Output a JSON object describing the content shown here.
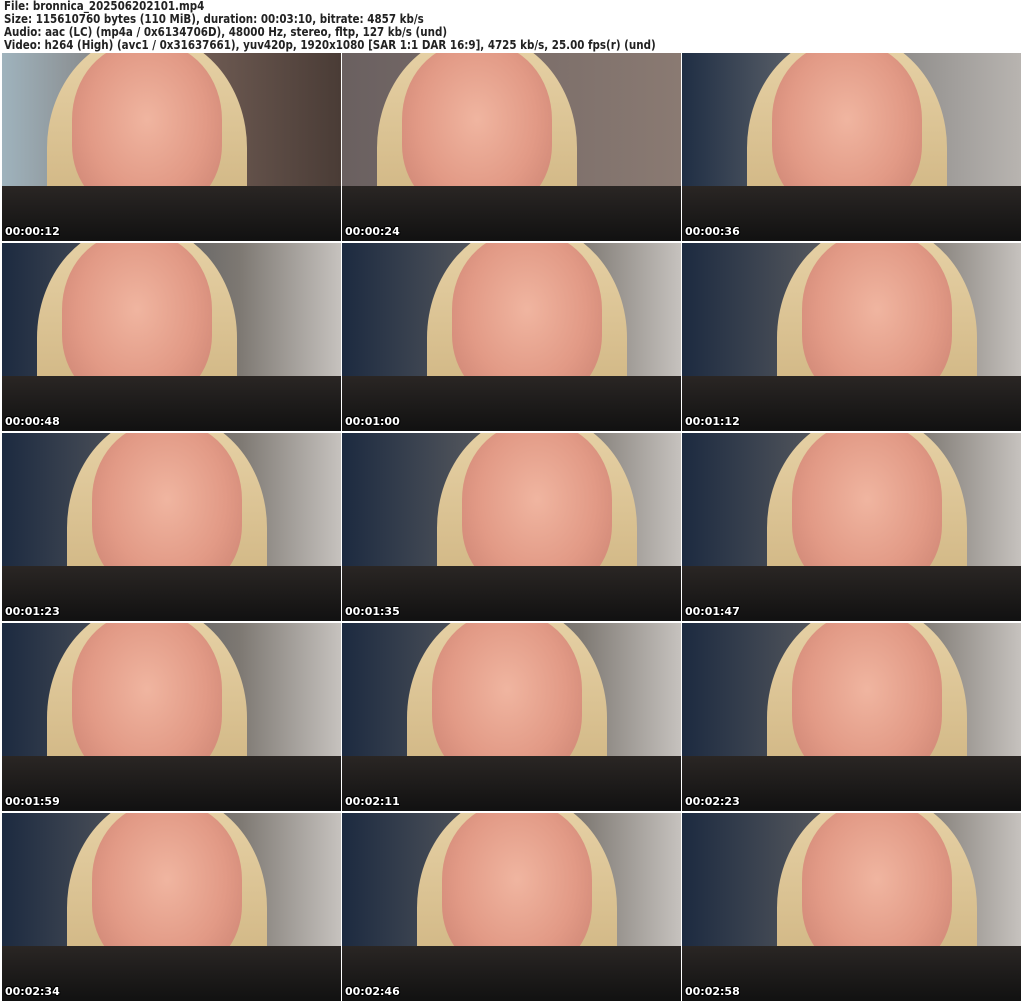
{
  "header": {
    "file": "File: bronnica_202506202101.mp4",
    "size": "Size: 115610760 bytes (110 MiB), duration: 00:03:10, bitrate: 4857 kb/s",
    "audio": "Audio: aac (LC) (mp4a / 0x6134706D), 48000 Hz, stereo, fltp, 127 kb/s (und)",
    "video": "Video: h264 (High) (avc1 / 0x31637661), yuv420p, 1920x1080 [SAR 1:1 DAR 16:9], 4725 kb/s, 25.00 fps(r) (und)"
  },
  "thumbnails": [
    {
      "timestamp": "00:00:12"
    },
    {
      "timestamp": "00:00:24"
    },
    {
      "timestamp": "00:00:36"
    },
    {
      "timestamp": "00:00:48"
    },
    {
      "timestamp": "00:01:00"
    },
    {
      "timestamp": "00:01:12"
    },
    {
      "timestamp": "00:01:23"
    },
    {
      "timestamp": "00:01:35"
    },
    {
      "timestamp": "00:01:47"
    },
    {
      "timestamp": "00:01:59"
    },
    {
      "timestamp": "00:02:11"
    },
    {
      "timestamp": "00:02:23"
    },
    {
      "timestamp": "00:02:34"
    },
    {
      "timestamp": "00:02:46"
    },
    {
      "timestamp": "00:02:58"
    }
  ]
}
